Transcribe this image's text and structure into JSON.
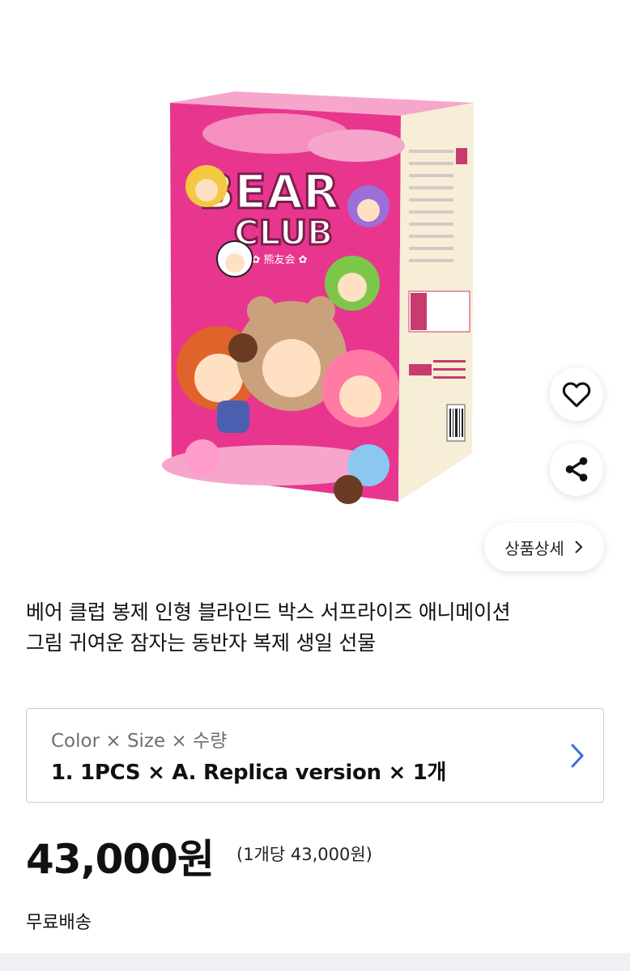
{
  "product": {
    "title_line1": "베어 클럽 봉제 인형 블라인드 박스 서프라이즈 애니메이션",
    "title_line2": "그림 귀여운 잠자는 동반자 복제 생일 선물",
    "image": {
      "brand_line1": "BEAR",
      "brand_line2": "CLUB",
      "brand_sub": "✿ 熊友会 ✿",
      "brand_color": "#e8368f",
      "side_color": "#f6eed6"
    }
  },
  "actions": {
    "detail_label": "상품상세",
    "wishlist_icon": "heart-icon",
    "share_icon": "share-icon"
  },
  "options": {
    "label": "Color × Size × 수량",
    "value": "1. 1PCS × A. Replica version × 1개"
  },
  "pricing": {
    "price": "43,000원",
    "unit_price": "(1개당 43,000원)"
  },
  "shipping": {
    "label": "무료배송"
  },
  "colors": {
    "accent": "#3b6fd8",
    "border": "#c9ccd1"
  }
}
